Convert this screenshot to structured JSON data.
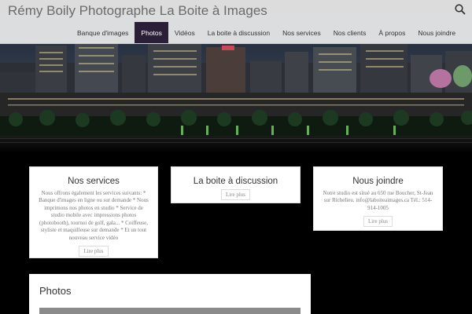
{
  "header": {
    "site_title": "Rémy Boily Photographe La Boite à Images",
    "search_icon": "search-icon"
  },
  "nav": {
    "items": [
      {
        "label": "Banque d'images",
        "active": false
      },
      {
        "label": "Photos",
        "active": true
      },
      {
        "label": "Vidéos",
        "active": false
      },
      {
        "label": "La boite à discussion",
        "active": false
      },
      {
        "label": "Nos services",
        "active": false
      },
      {
        "label": "Nos clients",
        "active": false
      },
      {
        "label": "À propos",
        "active": false
      },
      {
        "label": "Nous joindre",
        "active": false
      }
    ]
  },
  "cards": [
    {
      "title": "Nos services",
      "text": "Nous offrons également les services suivants: * Banque d'images en ligne ou sur demande * Nous imprimons nos photos en studio * Service de studio mobile avec impressions photos (photobooth), tournoi de golf, gala... * Coiffeuse, styliste et maquilleuse sur demande * Et un tout nouveau service vidéo",
      "more": "Lire plus"
    },
    {
      "title": "La boite à discussion",
      "text": "",
      "more": "Lire plus"
    },
    {
      "title": "Nous joindre",
      "text": "Notre studio est situé au 650 rue Boucher, St-Jean sur Richelieu. info@laboiteaimages.ca Tél.: 514-914-1005",
      "more": "Lire plus"
    }
  ],
  "photos": {
    "title": "Photos"
  },
  "colors": {
    "active_nav": "#2b1f38",
    "header_bg": "#ebebeb"
  }
}
